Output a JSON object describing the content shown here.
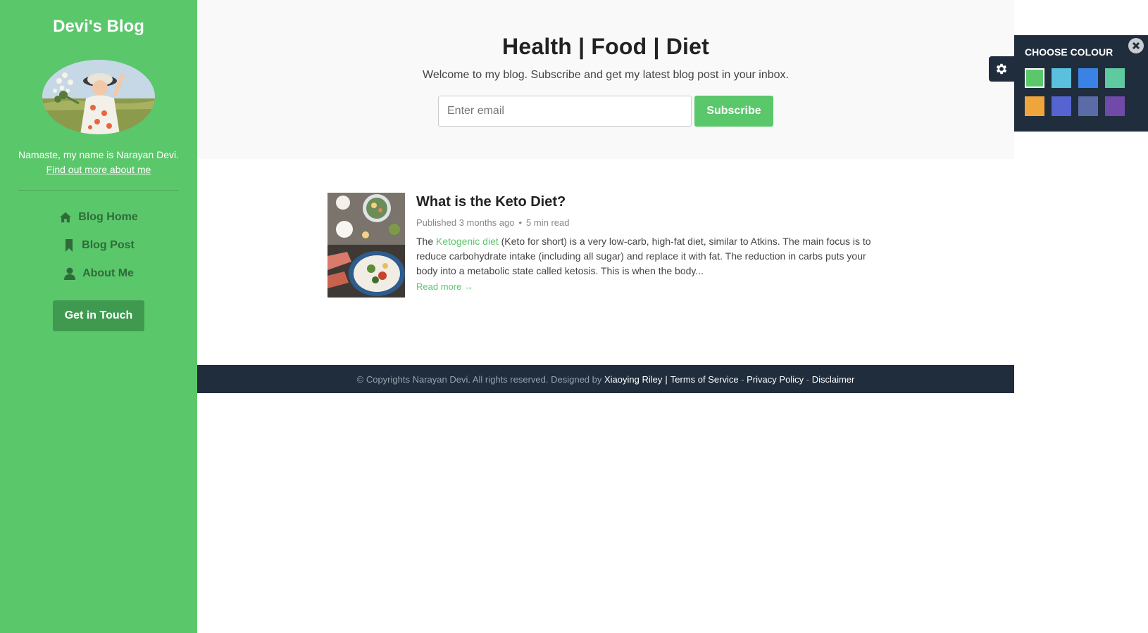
{
  "sidebar": {
    "site_title": "Devi's Blog",
    "bio": "Namaste, my name is Narayan Devi.",
    "bio_link": "Find out more about me",
    "nav": [
      {
        "label": "Blog Home",
        "icon": "home-icon"
      },
      {
        "label": "Blog Post",
        "icon": "bookmark-icon"
      },
      {
        "label": "About Me",
        "icon": "user-icon"
      }
    ],
    "cta": "Get in Touch"
  },
  "hero": {
    "title": "Health | Food | Diet",
    "intro": "Welcome to my blog. Subscribe and get my latest blog post in your inbox.",
    "email_placeholder": "Enter email",
    "subscribe_label": "Subscribe"
  },
  "post": {
    "title": "What is the Keto Diet?",
    "published": "Published 3 months ago",
    "read_time": "5 min read",
    "excerpt_prefix": "The ",
    "excerpt_link": "Ketogenic diet",
    "excerpt_rest": " (Keto for short) is a very low-carb, high-fat diet, similar to Atkins. The main focus is to reduce carbohydrate intake (including all sugar) and replace it with fat. The reduction in carbs puts your body into a metabolic state called ketosis. This is when the body...",
    "read_more": "Read more →"
  },
  "footer": {
    "copyright": "© Copyrights Narayan Devi. All rights reserved. Designed by",
    "designer": "Xiaoying Riley",
    "links": [
      "Terms of Service",
      "Privacy Policy",
      "Disclaimer"
    ],
    "separator": "-"
  },
  "colour_picker": {
    "title": "CHOOSE COLOUR",
    "swatches": [
      "#5bc76b",
      "#5bc0de",
      "#3a82e6",
      "#5fcaa0",
      "#f0a53b",
      "#5664d2",
      "#5b6ba8",
      "#6f4aa8"
    ],
    "selected": "#5bc76b"
  },
  "colors": {
    "accent": "#5bc76b",
    "dark_panel": "#1f2d3d"
  }
}
